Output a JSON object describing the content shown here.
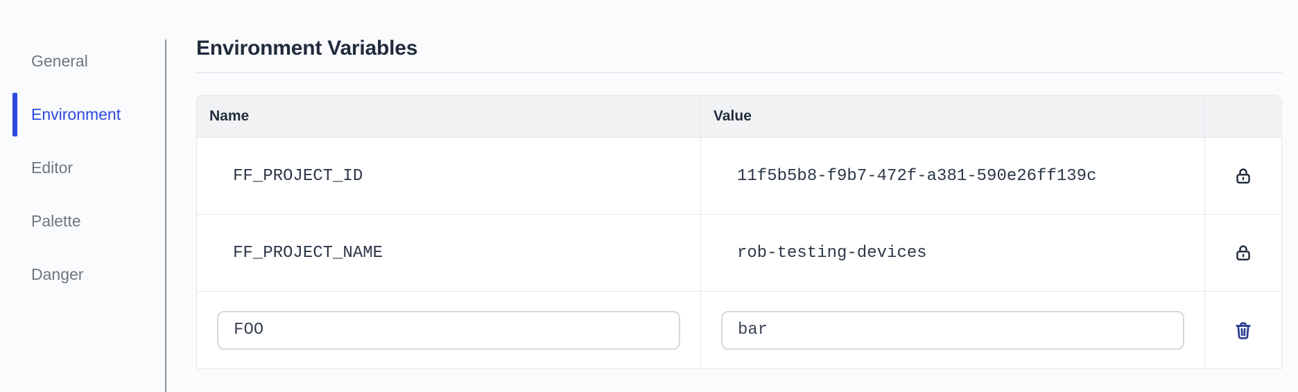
{
  "sidebar": {
    "items": [
      {
        "label": "General",
        "active": false
      },
      {
        "label": "Environment",
        "active": true
      },
      {
        "label": "Editor",
        "active": false
      },
      {
        "label": "Palette",
        "active": false
      },
      {
        "label": "Danger",
        "active": false
      }
    ]
  },
  "main": {
    "title": "Environment Variables",
    "table": {
      "columns": {
        "name": "Name",
        "value": "Value"
      },
      "rows": [
        {
          "name": "FF_PROJECT_ID",
          "value": "11f5b5b8-f9b7-472f-a381-590e26ff139c",
          "locked": true
        },
        {
          "name": "FF_PROJECT_NAME",
          "value": "rob-testing-devices",
          "locked": true
        }
      ],
      "editable_row": {
        "name_value": "FOO",
        "value_value": "bar"
      }
    }
  },
  "icons": {
    "locked_row": "lock-icon",
    "editable_row": "trash-icon"
  },
  "colors": {
    "accent_blue": "#2d49de",
    "trash_blue": "#2b3a8f",
    "icon_dark": "#252f3e",
    "header_bg": "#f1f2f4",
    "page_bg": "#fafbfc",
    "border": "#e4e6ea"
  }
}
